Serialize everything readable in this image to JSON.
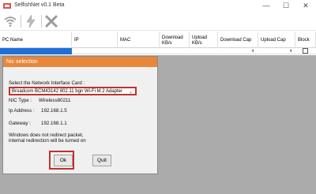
{
  "window": {
    "title": "SelfishNet v0.1 Beta",
    "min": "—",
    "max": "☐",
    "close": "✕"
  },
  "toolbar": {
    "buttons": [
      "wifi-icon",
      "lightning-icon",
      "close-x-icon"
    ]
  },
  "table": {
    "columns": [
      "PC Name",
      "IP",
      "MAC",
      "Download KB/s",
      "Upload KB/s",
      "Download Cap",
      "Upload Cap",
      "Block"
    ],
    "row": {
      "download_cap": "",
      "upload_cap": ""
    }
  },
  "dialog": {
    "title": "Nic selection",
    "select_label": "Select the Network Interface Card :",
    "selected_adapter": "Broadcom BCM43142 802.11 bgn Wi-Fi M.2 Adapter",
    "nic_type_label": "NIC Type :",
    "nic_type_value": "Wireless80211",
    "ip_label": "Ip Address :",
    "ip_value": "192.168.1.5",
    "gateway_label": "Gateway :",
    "gateway_value": "192.168.1.1",
    "note_line1": "Windows does not redirect packet,",
    "note_line2": "internal redirection will be turned on",
    "ok_label": "Ok",
    "quit_label": "Quit"
  },
  "colors": {
    "dialog_title_bg": "#e8863a",
    "selection_blue": "#1f6fd6",
    "highlight_red": "#c4302b",
    "workarea_gray": "#ababab"
  }
}
